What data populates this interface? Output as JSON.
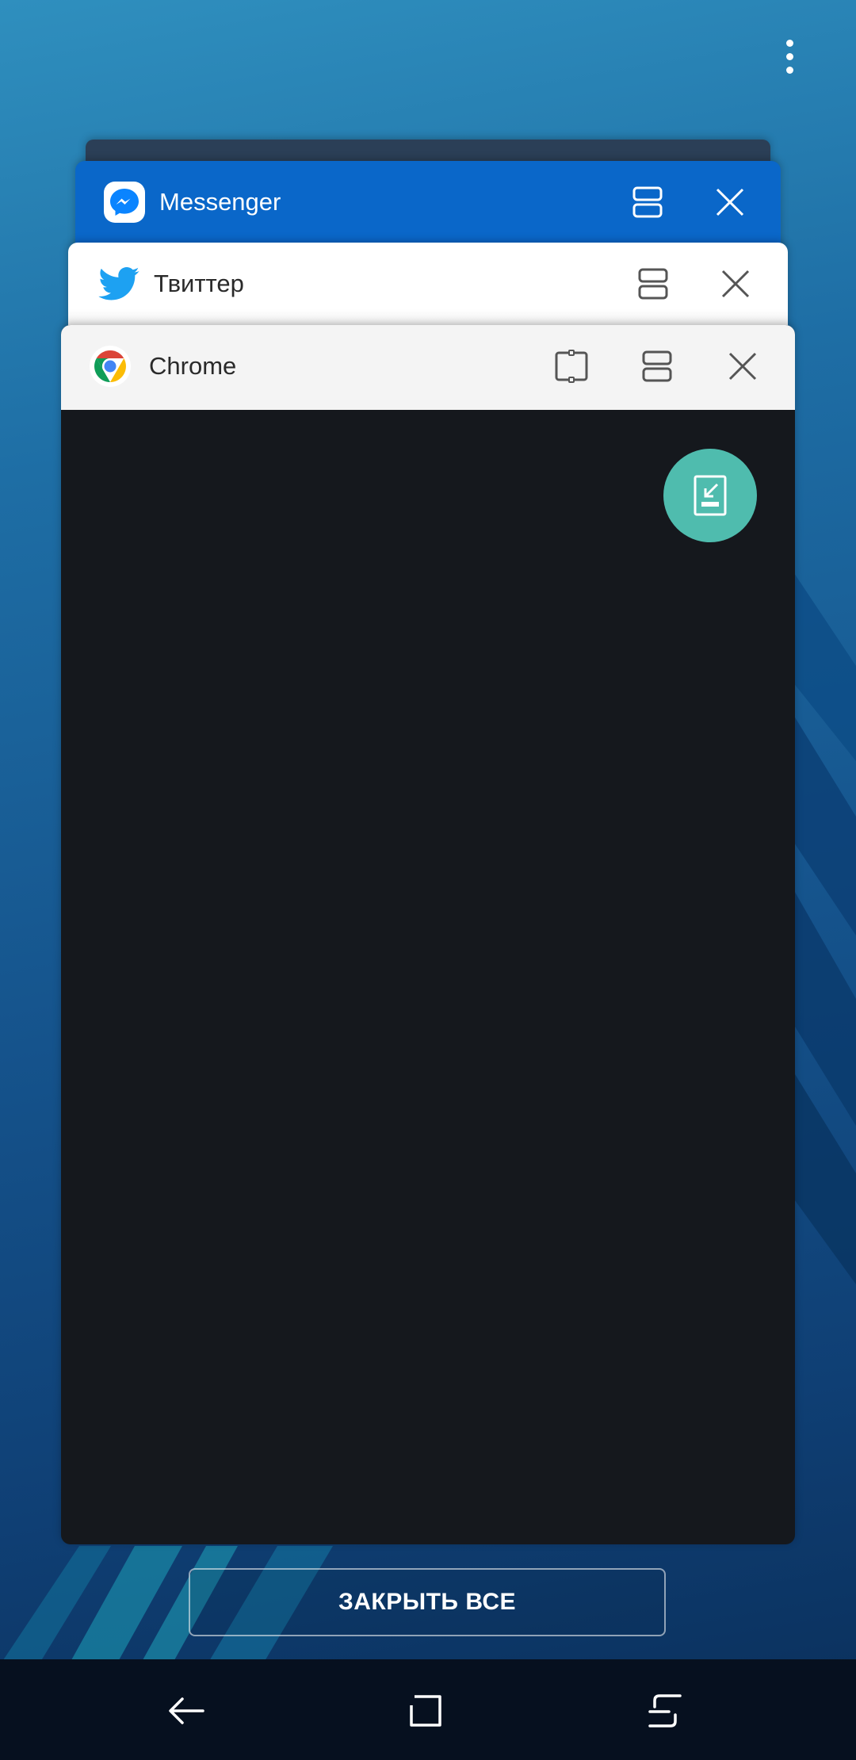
{
  "recents": {
    "cards": [
      {
        "app_name": "Messenger",
        "icon": "messenger-icon",
        "color": "#0a67c9"
      },
      {
        "app_name": "Твиттер",
        "icon": "twitter-icon",
        "color": "#1da1f2"
      },
      {
        "app_name": "Chrome",
        "icon": "chrome-icon",
        "color": "#15181d"
      }
    ],
    "close_all_label": "ЗАКРЫТЬ ВСЕ"
  },
  "icons": {
    "menu": "more-vert-icon",
    "split_screen": "split-screen-icon",
    "close": "close-icon",
    "pop_up_view": "pop-up-view-icon",
    "lock": "lock-app-icon"
  },
  "navigation": {
    "back": "back-icon",
    "home": "home-icon",
    "recents": "recents-icon"
  },
  "colors": {
    "fab": "#4fbcae",
    "nav_bar": "#06101f"
  }
}
